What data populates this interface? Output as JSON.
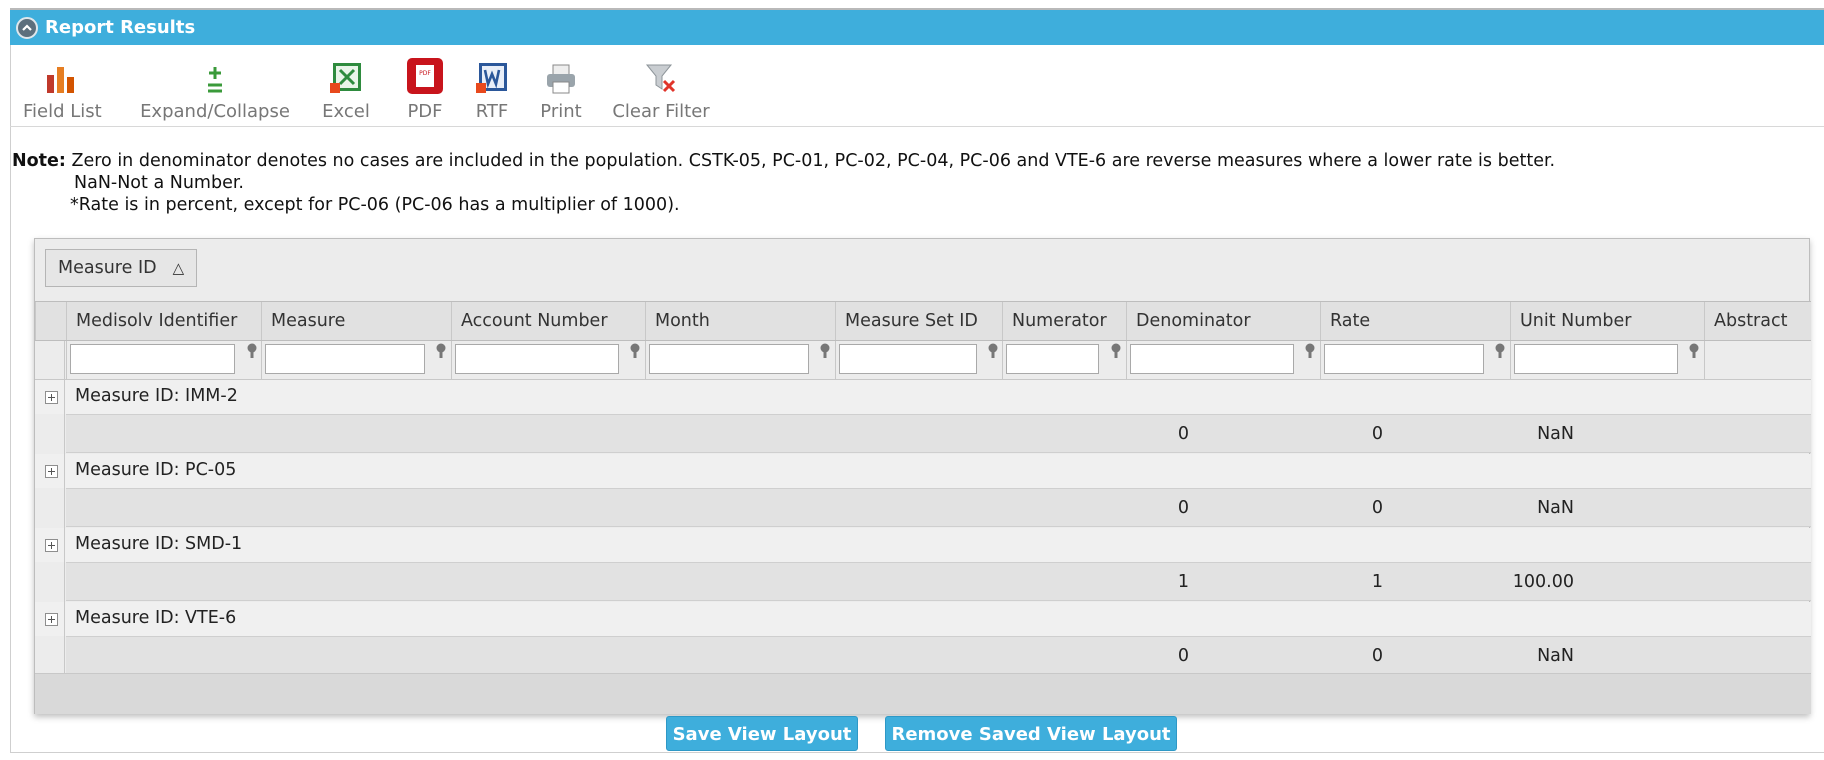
{
  "panel": {
    "title": "Report Results",
    "collapse_icon": "chevron-up-circle-icon"
  },
  "toolbar": {
    "field_list": "Field List",
    "expand_collapse": "Expand/Collapse",
    "excel": "Excel",
    "pdf": "PDF",
    "rtf": "RTF",
    "print": "Print",
    "clear_filter": "Clear Filter"
  },
  "note": {
    "label": "Note:",
    "line1": "Zero in denominator denotes no cases are included in the population. CSTK-05, PC-01, PC-02, PC-04, PC-06 and VTE-6 are reverse measures where a lower rate is better.",
    "line2": "NaN-Not a Number.",
    "line3": "*Rate is in percent, except for PC-06 (PC-06 has a multiplier of 1000)."
  },
  "grid": {
    "group_by": "Measure ID",
    "columns": [
      "Medisolv Identifier",
      "Measure",
      "Account Number",
      "Month",
      "Measure Set ID",
      "Numerator",
      "Denominator",
      "Rate",
      "Unit Number",
      "Abstract"
    ],
    "groups": [
      {
        "label": "Measure ID: IMM-2",
        "numerator": "0",
        "denominator": "0",
        "rate": "NaN"
      },
      {
        "label": "Measure ID: PC-05",
        "numerator": "0",
        "denominator": "0",
        "rate": "NaN"
      },
      {
        "label": "Measure ID: SMD-1",
        "numerator": "1",
        "denominator": "1",
        "rate": "100.00"
      },
      {
        "label": "Measure ID: VTE-6",
        "numerator": "0",
        "denominator": "0",
        "rate": "NaN"
      }
    ]
  },
  "buttons": {
    "save": "Save View Layout",
    "remove": "Remove Saved View Layout"
  },
  "colors": {
    "accent": "#3eaedc"
  }
}
